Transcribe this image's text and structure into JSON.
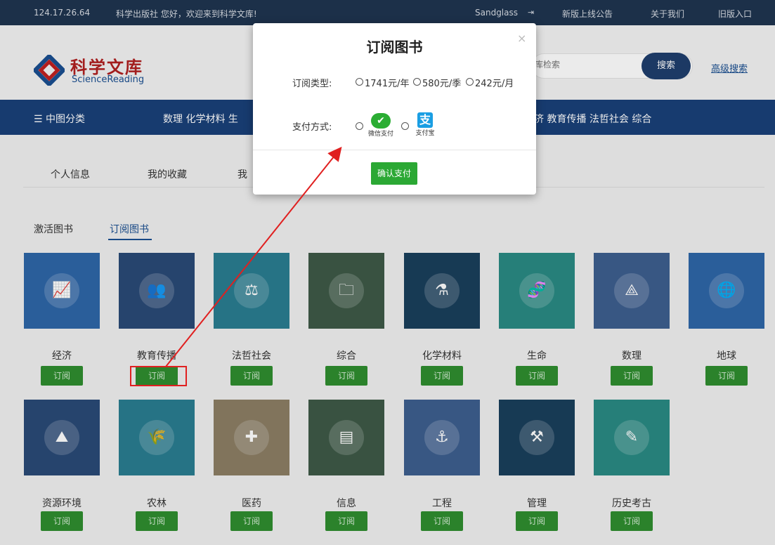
{
  "topbar": {
    "ip": "124.17.26.64",
    "welcome": "科学出版社 您好，欢迎来到科学文库!",
    "user": "Sandglass",
    "links": [
      "新版上线公告",
      "关于我们",
      "旧版入口"
    ]
  },
  "header": {
    "logo_cn": "科学文库",
    "logo_en": "ScienceReading",
    "search_placeholder": "库检索",
    "search_button": "搜索",
    "advanced_search": "高级搜索"
  },
  "nav": {
    "menu_label": "☰ 中图分类",
    "left_items": "数理 化学材料 生",
    "right_items": "济 教育传播 法哲社会 综合"
  },
  "tabs": [
    "个人信息",
    "我的收藏",
    "我"
  ],
  "subtabs": [
    "激活图书",
    "订阅图书"
  ],
  "categories": [
    {
      "name": "经济",
      "button": "订阅",
      "color": "#2e66a8",
      "icon": "growth-chart-icon"
    },
    {
      "name": "教育传播",
      "button": "订阅",
      "color": "#2a4a77",
      "icon": "audience-icon"
    },
    {
      "name": "法哲社会",
      "button": "订阅",
      "color": "#2a7d91",
      "icon": "balance-scale-icon"
    },
    {
      "name": "综合",
      "button": "订阅",
      "color": "#3e5a47",
      "icon": "folder-icon"
    },
    {
      "name": "化学材料",
      "button": "订阅",
      "color": "#1a3f5c",
      "icon": "lab-flask-icon"
    },
    {
      "name": "生命",
      "button": "订阅",
      "color": "#2a8a84",
      "icon": "dna-icon"
    },
    {
      "name": "数理",
      "button": "订阅",
      "color": "#3d5f8f",
      "icon": "compass-icon"
    },
    {
      "name": "地球",
      "button": "订阅",
      "color": "#2e66a8",
      "icon": "globe-icon"
    },
    {
      "name": "资源环境",
      "button": "订阅",
      "color": "#2a4a77",
      "icon": "mountain-icon"
    },
    {
      "name": "农林",
      "button": "订阅",
      "color": "#2a7d91",
      "icon": "wheat-icon"
    },
    {
      "name": "医药",
      "button": "订阅",
      "color": "#8c7e64",
      "icon": "medical-kit-icon"
    },
    {
      "name": "信息",
      "button": "订阅",
      "color": "#3e5a47",
      "icon": "presentation-icon"
    },
    {
      "name": "工程",
      "button": "订阅",
      "color": "#3d5f8f",
      "icon": "crane-hook-icon"
    },
    {
      "name": "管理",
      "button": "订阅",
      "color": "#1a3f5c",
      "icon": "worker-tools-icon"
    },
    {
      "name": "历史考古",
      "button": "订阅",
      "color": "#2a8a84",
      "icon": "brush-icon"
    }
  ],
  "modal": {
    "title": "订阅图书",
    "close": "×",
    "type_label": "订阅类型:",
    "options": [
      "1741元/年",
      "580元/季",
      "242元/月"
    ],
    "pay_label": "支付方式:",
    "wechat_label": "微信支付",
    "alipay_label": "支付宝",
    "confirm": "确认支付"
  }
}
